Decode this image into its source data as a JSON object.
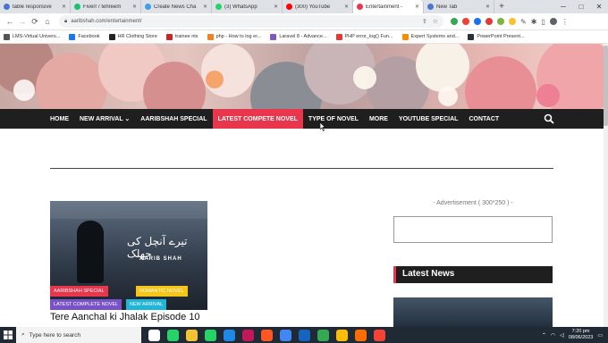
{
  "browser": {
    "tabs": [
      {
        "label": "table responsive",
        "color": "#4a76d1"
      },
      {
        "label": "Fiverr / tehreem",
        "color": "#1dbf73"
      },
      {
        "label": "Create News Cha",
        "color": "#3da0e8"
      },
      {
        "label": "(3) WhatsApp",
        "color": "#25d366"
      },
      {
        "label": "(300) YouTube",
        "color": "#ff0000"
      },
      {
        "label": "Entertainment -",
        "color": "#e8374d"
      },
      {
        "label": "New Tab",
        "color": "#4a76d1"
      }
    ],
    "active_tab": 5,
    "new_tab": "+",
    "window_controls": [
      "─",
      "□",
      "✕"
    ],
    "url": "aaribshah.com/entertainment/",
    "bookmarks": [
      {
        "label": "LMS-Virtual Univers...",
        "color": "#555555"
      },
      {
        "label": "Facebook",
        "color": "#1877f2"
      },
      {
        "label": "HR Clothing Store",
        "color": "#222222"
      },
      {
        "label": "trainee nts",
        "color": "#c62828"
      },
      {
        "label": "php - How to log er...",
        "color": "#f48024"
      },
      {
        "label": "Laravel 8 - Advance...",
        "color": "#7e57c2"
      },
      {
        "label": "PHP error_log() Fun...",
        "color": "#e53935"
      },
      {
        "label": "Expert Systems and...",
        "color": "#fb8c00"
      },
      {
        "label": "PowerPoint Present...",
        "color": "#263238"
      }
    ]
  },
  "site": {
    "nav": [
      {
        "label": "HOME",
        "highlight": false
      },
      {
        "label": "NEW ARRIVAL ⌄",
        "highlight": false
      },
      {
        "label": "AARIBSHAH SPECIAL",
        "highlight": false
      },
      {
        "label": "LATEST COMPETE NOVEL",
        "highlight": true
      },
      {
        "label": "TYPE OF NOVEL",
        "highlight": false
      },
      {
        "label": "MORE",
        "highlight": false
      },
      {
        "label": "YOUTUBE SPECIAL",
        "highlight": false
      },
      {
        "label": "CONTACT",
        "highlight": false
      }
    ],
    "accent": "#e8374d",
    "post": {
      "categories": [
        {
          "label": "AARIBSHAH SPECIAL",
          "color": "#e8374d"
        },
        {
          "label": "ROMANTIC NOVEL",
          "color": "#f5c518"
        },
        {
          "label": "LATEST COMPLETE NOVEL",
          "color": "#7a52c7"
        },
        {
          "label": "NEW ARRIVAL",
          "color": "#1fb5d6"
        }
      ],
      "title": "Tere Aanchal ki Jhalak Episode 10",
      "image_text": "تیرے آنچل کی جھلک",
      "image_author": "AARIB SHAH"
    },
    "sidebar": {
      "ad_label": "- Advertisement ( 300*250 ) -",
      "latest_news_heading": "Latest News"
    }
  },
  "taskbar": {
    "search_placeholder": "Type here to search",
    "apps": [
      "#ffffff",
      "#25d366",
      "#f4c430",
      "#25d366",
      "#1e88e5",
      "#c2185b",
      "#ff5722",
      "#4285f4",
      "#1565c0",
      "#34a853",
      "#fbbc05",
      "#ff6d00",
      "#f44336"
    ],
    "time": "7:20 pm",
    "date": "08/06/2023"
  }
}
